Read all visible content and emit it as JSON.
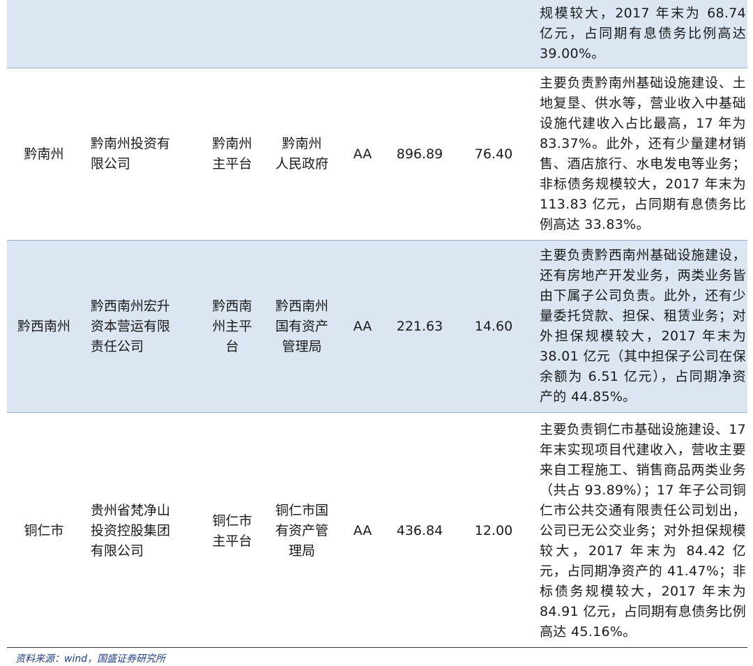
{
  "rows": [
    {
      "region": "",
      "company": "",
      "type": "",
      "holder": "",
      "rating": "",
      "assets": "",
      "revenue": "",
      "desc": "规模较大，2017 年末为 68.74 亿元，占同期有息债务比例高达 39.00%。"
    },
    {
      "region": "黔南州",
      "company": "黔南州投资有\n限公司",
      "type": "黔南州\n主平台",
      "holder": "黔南州\n人民政府",
      "rating": "AA",
      "assets": "896.89",
      "revenue": "76.40",
      "desc": "主要负责黔南州基础设施建设、土地复垦、供水等，营业收入中基础设施代建收入占比最高，17 年为 83.37%。此外，还有少量建材销售、酒店旅行、水电发电等业务；非标债务规模较大，2017 年末为 113.83 亿元，占同期有息债务比例高达 33.83%。"
    },
    {
      "region": "黔西南州",
      "company": "黔西南州宏升\n资本营运有限\n责任公司",
      "type": "黔西南\n州主平\n台",
      "holder": "黔西南州\n国有资产\n管理局",
      "rating": "AA",
      "assets": "221.63",
      "revenue": "14.60",
      "desc": "主要负责黔西南州基础设施建设，还有房地产开发业务，两类业务皆由下属子公司负责。此外，还有少量委托贷款、担保、租赁业务；对外担保规模较大，2017 年末为 38.01 亿元（其中担保子公司在保余额为 6.51 亿元），占同期净资产的 44.85%。"
    },
    {
      "region": "铜仁市",
      "company": "贵州省梵净山\n投资控股集团\n有限公司",
      "type": "铜仁市\n主平台",
      "holder": "铜仁市国\n有资产管\n理局",
      "rating": "AA",
      "assets": "436.84",
      "revenue": "12.00",
      "desc": "主要负责铜仁市基础设施建设、17 年末实现项目代建收入，营收主要来自工程施工、销售商品两类业务（共占 93.89%）；17 年子公司铜仁市公共交通有限责任公司划出，公司已无公交业务；对外担保规模较大，2017 年末为 84.42 亿元，占同期净资产的 41.47%；非标债务规模较大，2017 年末为 84.91 亿元，占同期有息债务比例高达 45.16%。"
    }
  ],
  "source": "资料来源：wind，国盛证券研究所",
  "colors": {
    "shade": "#dce6f2",
    "source_text": "#1f3d8a"
  }
}
